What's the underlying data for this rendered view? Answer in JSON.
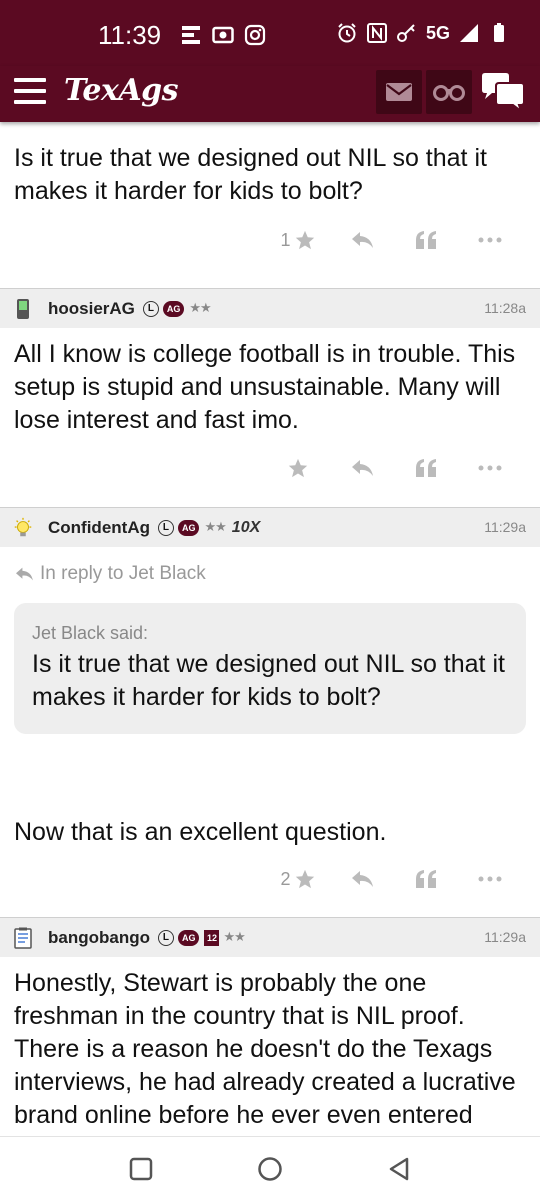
{
  "status_bar": {
    "time": "11:39",
    "network": "5G",
    "left_icons": [
      "notes-icon",
      "radio-icon",
      "instagram-icon"
    ],
    "right_icons": [
      "alarm-icon",
      "nfc-icon",
      "key-icon",
      "signal-icon",
      "battery-icon"
    ]
  },
  "app_bar": {
    "logo": "TexAgs",
    "buttons": [
      "menu-icon",
      "mail-icon",
      "binoculars-icon",
      "chat-icon"
    ]
  },
  "posts": [
    {
      "body": "Is it true that we designed out NIL so that it makes it harder for kids to bolt?",
      "star_count": "1"
    },
    {
      "username": "hoosierAG",
      "badges": [
        "L",
        "AG"
      ],
      "stars": "★★",
      "time": "11:28a",
      "body": "All I know is college football is in trouble. This setup is stupid and unsustainable. Many will lose interest and fast imo.",
      "star_count": ""
    },
    {
      "username": "ConfidentAg",
      "badges": [
        "L",
        "AG"
      ],
      "stars": "★★",
      "extra_badge": "10X",
      "time": "11:29a",
      "reply_to": "In reply to Jet Black",
      "quote_author": "Jet Black said:",
      "quote_text": "Is it true that we designed out NIL so that it makes it harder for kids to bolt?",
      "body": "Now that is an excellent question.",
      "star_count": "2"
    },
    {
      "username": "bangobango",
      "badges": [
        "L",
        "AG",
        "12"
      ],
      "stars": "★★",
      "time": "11:29a",
      "body": "Honestly, Stewart is probably the one freshman in the country that is NIL proof. There is a reason he doesn't do the Texags interviews, he had already created a lucrative brand online before he ever even entered college."
    }
  ],
  "nav_bar": [
    "recents-button",
    "home-button",
    "back-button"
  ],
  "colors": {
    "brand": "#5b0a22",
    "header_bg": "#eeeeee",
    "icon_gray": "#bbbbbb"
  }
}
